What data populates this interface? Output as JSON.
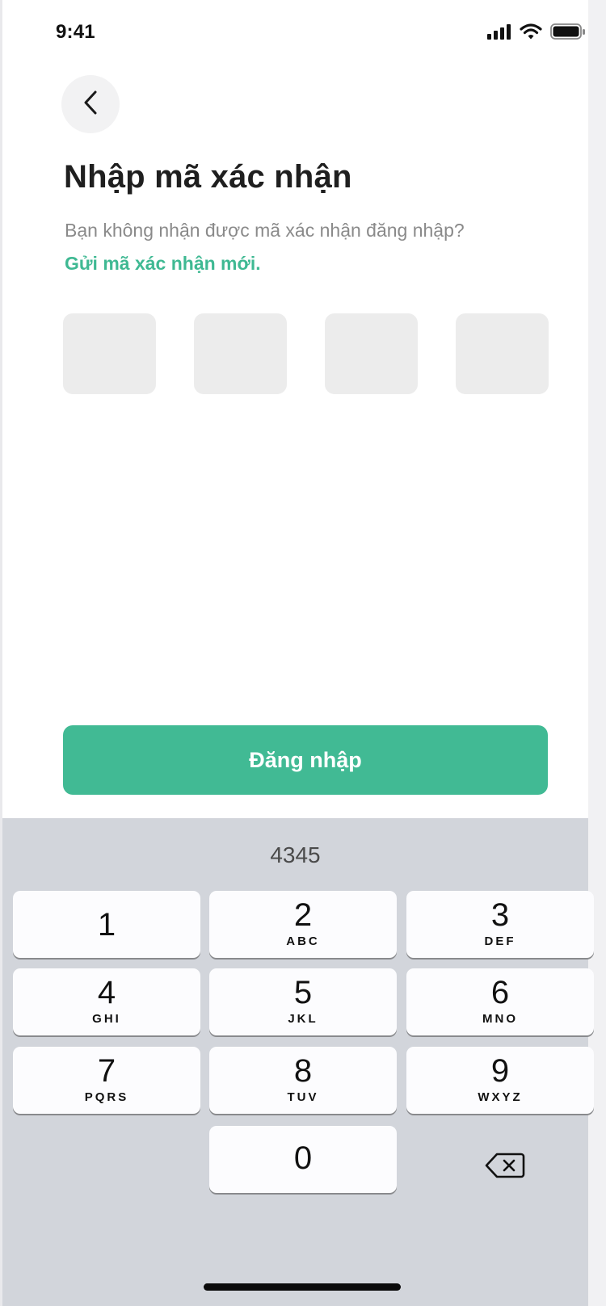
{
  "status_bar": {
    "time": "9:41"
  },
  "header": {
    "back_icon": "chevron-left-icon",
    "title": "Nhập mã xác nhận",
    "subtitle": "Bạn không nhận được mã xác nhận đăng nhập?",
    "resend_link": "Gửi mã xác nhận mới."
  },
  "code_inputs": [
    {
      "value": ""
    },
    {
      "value": ""
    },
    {
      "value": ""
    },
    {
      "value": ""
    }
  ],
  "login_button": {
    "label": "Đăng nhập"
  },
  "keyboard": {
    "suggestion": "4345",
    "keys": [
      {
        "digit": "1",
        "letters": ""
      },
      {
        "digit": "2",
        "letters": "ABC"
      },
      {
        "digit": "3",
        "letters": "DEF"
      },
      {
        "digit": "4",
        "letters": "GHI"
      },
      {
        "digit": "5",
        "letters": "JKL"
      },
      {
        "digit": "6",
        "letters": "MNO"
      },
      {
        "digit": "7",
        "letters": "PQRS"
      },
      {
        "digit": "8",
        "letters": "TUV"
      },
      {
        "digit": "9",
        "letters": "WXYZ"
      },
      {
        "digit": "0",
        "letters": ""
      }
    ],
    "delete_icon": "backspace-icon"
  },
  "colors": {
    "accent": "#41ba94",
    "link": "#3fb993",
    "code_box": "#ececec",
    "keyboard_bg": "#d2d5db"
  }
}
